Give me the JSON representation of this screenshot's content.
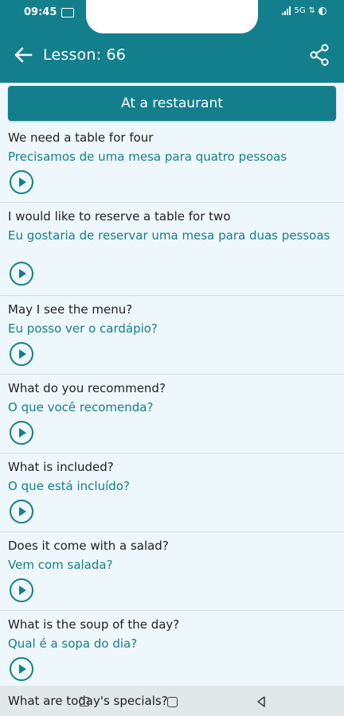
{
  "status_bar": {
    "time": "09:45",
    "network": "5G"
  },
  "app_bar": {
    "title": "Lesson: 66"
  },
  "lesson": {
    "heading": "At a restaurant"
  },
  "phrases": [
    {
      "en": "We need a table for four",
      "pt": "Precisamos de uma mesa para quatro pessoas"
    },
    {
      "en": "I would like to reserve a table for two",
      "pt": "Eu gostaria de reservar uma mesa para duas pessoas"
    },
    {
      "en": "May I see the menu?",
      "pt": "Eu posso ver o cardápio?"
    },
    {
      "en": "What do you recommend?",
      "pt": "O que você recomenda?"
    },
    {
      "en": "What is included?",
      "pt": "O que está incluído?"
    },
    {
      "en": "Does it come with a salad?",
      "pt": "Vem com salada?"
    },
    {
      "en": "What is the soup of the day?",
      "pt": "Qual é a sopa do dia?"
    }
  ],
  "partial_phrase": {
    "en": "What are today's specials?"
  },
  "icons": {
    "back": "arrow-left-icon",
    "share": "share-icon",
    "play": "play-circle-icon",
    "nav_recent": "recent-apps-icon",
    "nav_home": "home-icon",
    "nav_back": "triangle-back-icon"
  },
  "colors": {
    "primary": "#137f8c",
    "background": "#eef7fb",
    "text": "#222222"
  }
}
